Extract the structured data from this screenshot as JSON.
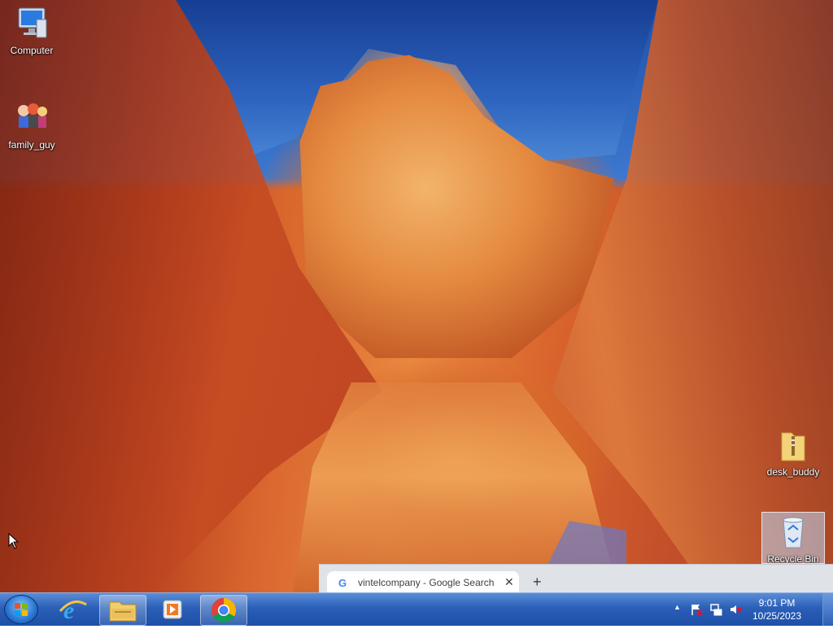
{
  "desktop": {
    "icons": [
      {
        "label": "Computer",
        "icon": "computer-icon"
      },
      {
        "label": "family_guy",
        "icon": "family-guy-icon"
      },
      {
        "label": "desk_buddy",
        "icon": "zip-folder-icon"
      },
      {
        "label": "Recycle Bin",
        "icon": "recycle-bin-icon"
      }
    ]
  },
  "chrome": {
    "tab_title": "vintelcompany - Google Search",
    "tab_favicon": "G",
    "close_glyph": "✕",
    "new_tab_glyph": "+"
  },
  "taskbar": {
    "start": "start-orb",
    "pinned": [
      "internet-explorer-icon",
      "file-explorer-icon",
      "media-player-icon",
      "chrome-icon"
    ],
    "tray": {
      "expand_glyph": "▲",
      "time": "9:01 PM",
      "date": "10/25/2023"
    }
  },
  "colors": {
    "taskbar": "#1e4fa6",
    "chrome_frame": "#dfe3e8",
    "recycle_highlight": "#bed7f5"
  }
}
